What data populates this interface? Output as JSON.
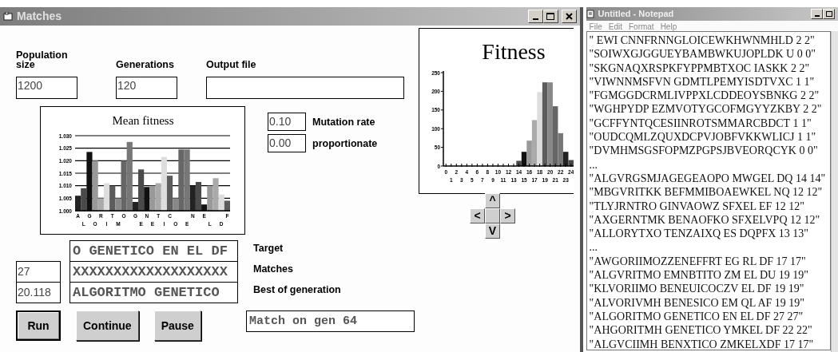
{
  "matches_window": {
    "title": "Matches",
    "fields": [
      {
        "label": "Population size",
        "value": "1200"
      },
      {
        "label": "Generations",
        "value": "120"
      },
      {
        "label": "Output file"
      }
    ],
    "mean_fitness": {
      "chart_data": {
        "type": "bar",
        "title": "Mean fitness",
        "grid": true,
        "categories": [
          "A",
          "L",
          "G",
          "O",
          "R",
          "I",
          "T",
          "M",
          "O",
          null,
          "G",
          "E",
          "N",
          "E",
          "T",
          "I",
          "C",
          "O",
          null,
          "E",
          "N",
          null,
          "E",
          "L",
          null,
          "D",
          "F"
        ],
        "series": [
          {
            "values": [
              1.006,
              1.009,
              1.0235,
              1.02,
              1.005,
              1.011,
              1.01,
              1.005,
              1.02,
              1.0275,
              1.0035,
              1.0165,
              1.0095,
              1.01,
              1.011,
              1.0215,
              1.014,
              1.005,
              1.0245,
              1.0245,
              1.01,
              1.0115,
              1.0025,
              1.01,
              1.013,
              1.0065,
              1.004
            ]
          }
        ],
        "ylim": [
          1.0,
          1.03
        ],
        "yticks": [
          {
            "value": 1.0,
            "label": "1.000"
          },
          {
            "value": 1.005,
            "label": "1.005"
          },
          {
            "value": 1.01,
            "label": "1.010"
          },
          {
            "value": 1.015,
            "label": "1.015"
          },
          {
            "value": 1.02,
            "label": "1.020"
          },
          {
            "value": 1.025,
            "label": "1.025"
          },
          {
            "value": 1.03,
            "label": "1.030"
          }
        ]
      }
    },
    "parameters": [
      {
        "value": "0.10",
        "label": "Mutation rate"
      },
      {
        "value": "0.00",
        "label": "proportionate"
      }
    ],
    "results": [
      {
        "label": "Target",
        "text": "O GENETICO EN EL DF"
      },
      {
        "label": "Matches",
        "count": "27",
        "text": "XXXXXXXXXXXXXXXXXXX"
      },
      {
        "label": "Best of generation",
        "count": "20.118",
        "text": "ALGORITMO GENETICO"
      }
    ],
    "buttons": [
      {
        "label": "Run",
        "default": true
      },
      {
        "label": "Continue",
        "default": false
      },
      {
        "label": "Pause",
        "default": false
      }
    ],
    "status": "Match on gen 64",
    "fitness": {
      "chart_data": {
        "type": "bar",
        "title": "Fitness",
        "categories": [
          "0",
          "1",
          "2",
          "3",
          "4",
          "5",
          "6",
          "7",
          "8",
          "9",
          "10",
          "11",
          "12",
          "13",
          "14",
          "15",
          "16",
          "17",
          "18",
          "19",
          "20",
          "21",
          "22",
          "23",
          "24"
        ],
        "series": [
          {
            "values": [
              0,
              0,
              0,
              0,
              0,
              0,
              0,
              0,
              0,
              0,
              0,
              0,
              0,
              null,
              14,
              38,
              68,
              123,
              198,
              224,
              224,
              160,
              88,
              38,
              16
            ]
          }
        ],
        "ylim": [
          0,
          250
        ],
        "yticks": [
          0,
          50,
          100,
          150,
          200,
          250
        ]
      }
    },
    "arrow_pad": {
      "up": "^",
      "left": "<",
      "right": ">",
      "down": "V"
    }
  },
  "notepad": {
    "title": "Untitled - Notepad",
    "menu": [
      "File",
      "Edit",
      "Format",
      "Help"
    ],
    "lines": [
      "\" EWI CNNFRNNGLOICEWKHWNMHLD 2 2\"",
      "\"SOIWXGJGGUEYBAMBWKUJOPLDK U 0 0\"",
      "\"SKGNAQXRSPKFYPPMBTXOC IASKK 2 2\"",
      "\"VIWNNMSFVN GDMTLPEMYISDTVXC 1 1\"",
      "\"FGMGGDCRMLIVPPXLCDDEOYSBNKG 2 2\"",
      "\"WGHPYDP EZMVOTYGCOFMGYYZKBY 2 2\"",
      "\"GCFFYNTQCESIINROTSMMARCBDCT 1 1\"",
      "\"OUDCQMLZQUXDCPVJOBFVKKWLICJ 1 1\"",
      "\"DVMHMSGSFOPMZPGPSJBVEORQCYK 0 0\"",
      "...",
      "\"ALGVRGSMJAGEGEAOPO MWGEL DQ 14 14\"",
      "\"MBGVRITKK BEFMMIBOAEWKEL NQ 12 12\"",
      "\"TLYJRNTRO GINVAOWZ SFXEL EF 12 12\"",
      "\"AXGERNTMK BENAOFKO SFXELVPQ 12 12\"",
      "\"ALLORYTXO TENZAIXQ ES DQPFX 13 13\"",
      "...",
      "\"AWGORIIMOZZENEFFRT EG RL DF 17 17\"",
      "\"ALGVRITMO EMNBTITO ZM EL DU 19 19\"",
      "\"KLVORIIMO BENEUICOCZV EL DF 19 19\"",
      "\"ALVORIVMH BENESICO EM QL AF 19 19\"",
      "\"ALGORITMO GENETICO EN EL DF 27 27\"",
      "\"AHGORITMH GENETICO YMKEL DF 22 22\"",
      "\"ALGVCIIMH BENXTICO ZMKELXDF 17 17\""
    ]
  }
}
